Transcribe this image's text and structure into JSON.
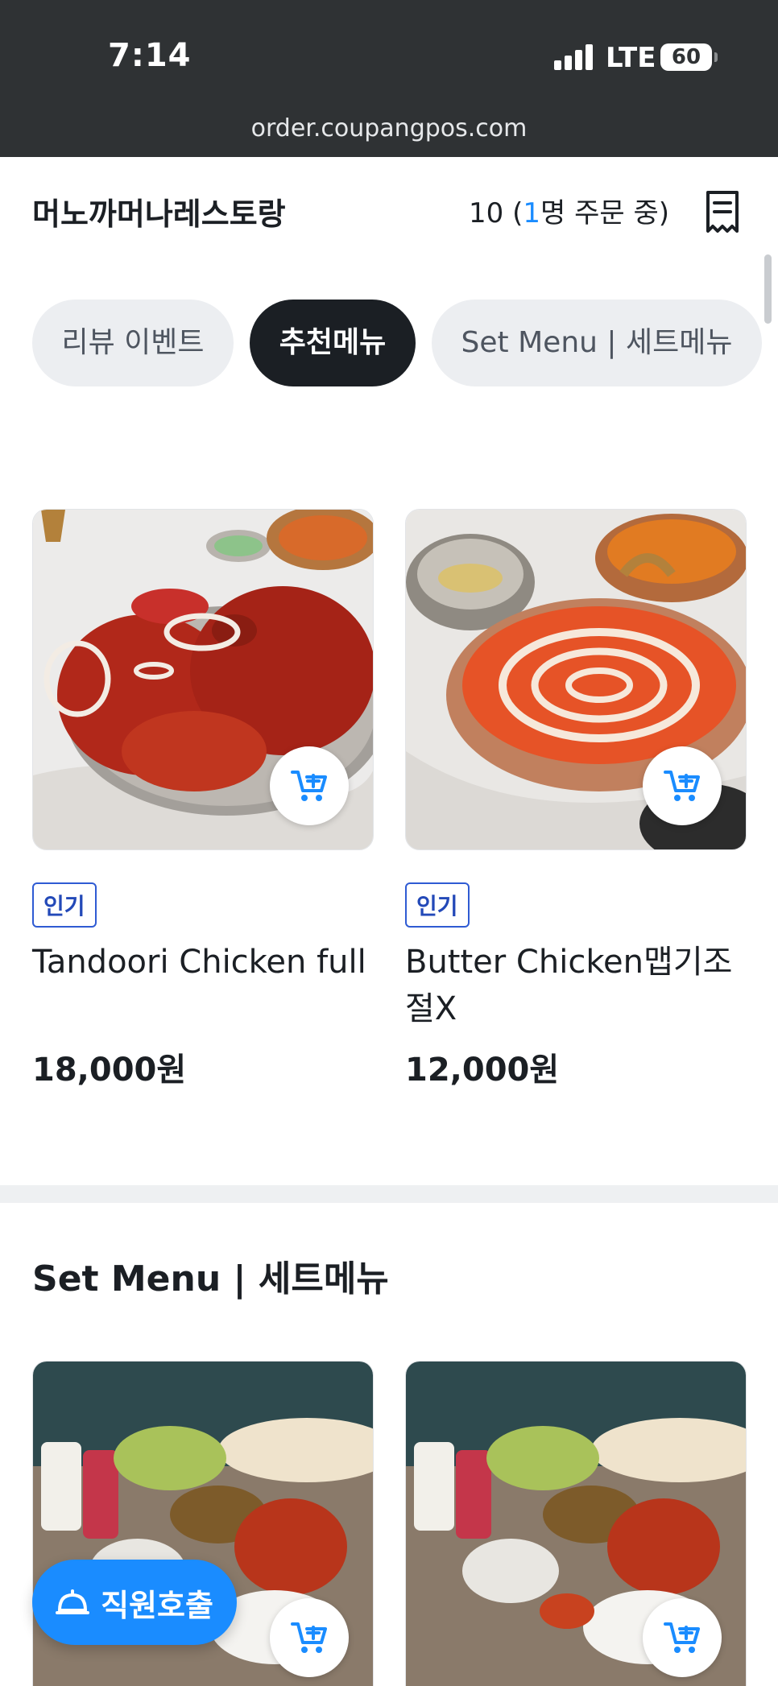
{
  "status_bar": {
    "time": "7:14",
    "network": "LTE",
    "battery": "60",
    "url": "order.coupangpos.com"
  },
  "header": {
    "store_name": "머노까머나레스토랑",
    "table_number": "10 (",
    "ordering_count": "1",
    "ordering_suffix": "명 주문 중)"
  },
  "categories": [
    {
      "label": "리뷰 이벤트",
      "active": false
    },
    {
      "label": "추천메뉴",
      "active": true
    },
    {
      "label": "Set Menu | 세트메뉴",
      "active": false
    }
  ],
  "recommended": [
    {
      "badge": "인기",
      "name": "Tandoori Chicken full",
      "price": "18,000원",
      "image": "tandoori-chicken-photo"
    },
    {
      "badge": "인기",
      "name": "Butter Chicken맵기조절X",
      "price": "12,000원",
      "image": "butter-chicken-photo"
    }
  ],
  "set_menu": {
    "title": "Set Menu | 세트메뉴",
    "items": [
      {
        "image": "set-menu-photo"
      },
      {
        "image": "set-menu-photo"
      }
    ]
  },
  "staff_call": {
    "label": "직원호출",
    "icon": "service-bell-icon"
  },
  "colors": {
    "accent": "#1a8cff",
    "badge_border": "#2f5bd3",
    "chip_active_bg": "#1b1f24",
    "chip_bg": "#eceef1",
    "statusbar_bg": "#2f3234"
  }
}
